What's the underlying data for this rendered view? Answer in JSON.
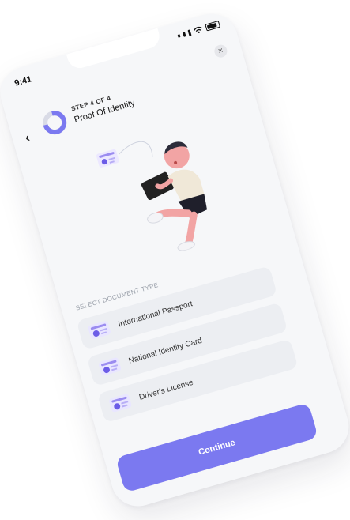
{
  "status": {
    "time": "9:41"
  },
  "header": {
    "step_label": "STEP 4 OF 4",
    "title": "Proof Of Identity"
  },
  "progress": {
    "fraction": 0.75
  },
  "section": {
    "label": "SELECT DOCUMENT TYPE"
  },
  "options": [
    {
      "label": "International Passport"
    },
    {
      "label": "National Identity Card"
    },
    {
      "label": "Driver's License"
    }
  ],
  "actions": {
    "continue_label": "Continue",
    "close_icon": "×",
    "back_icon": "‹"
  },
  "colors": {
    "accent": "#7b79f0",
    "ring_bg": "#d9dbe6",
    "background": "#f6f7f9"
  }
}
